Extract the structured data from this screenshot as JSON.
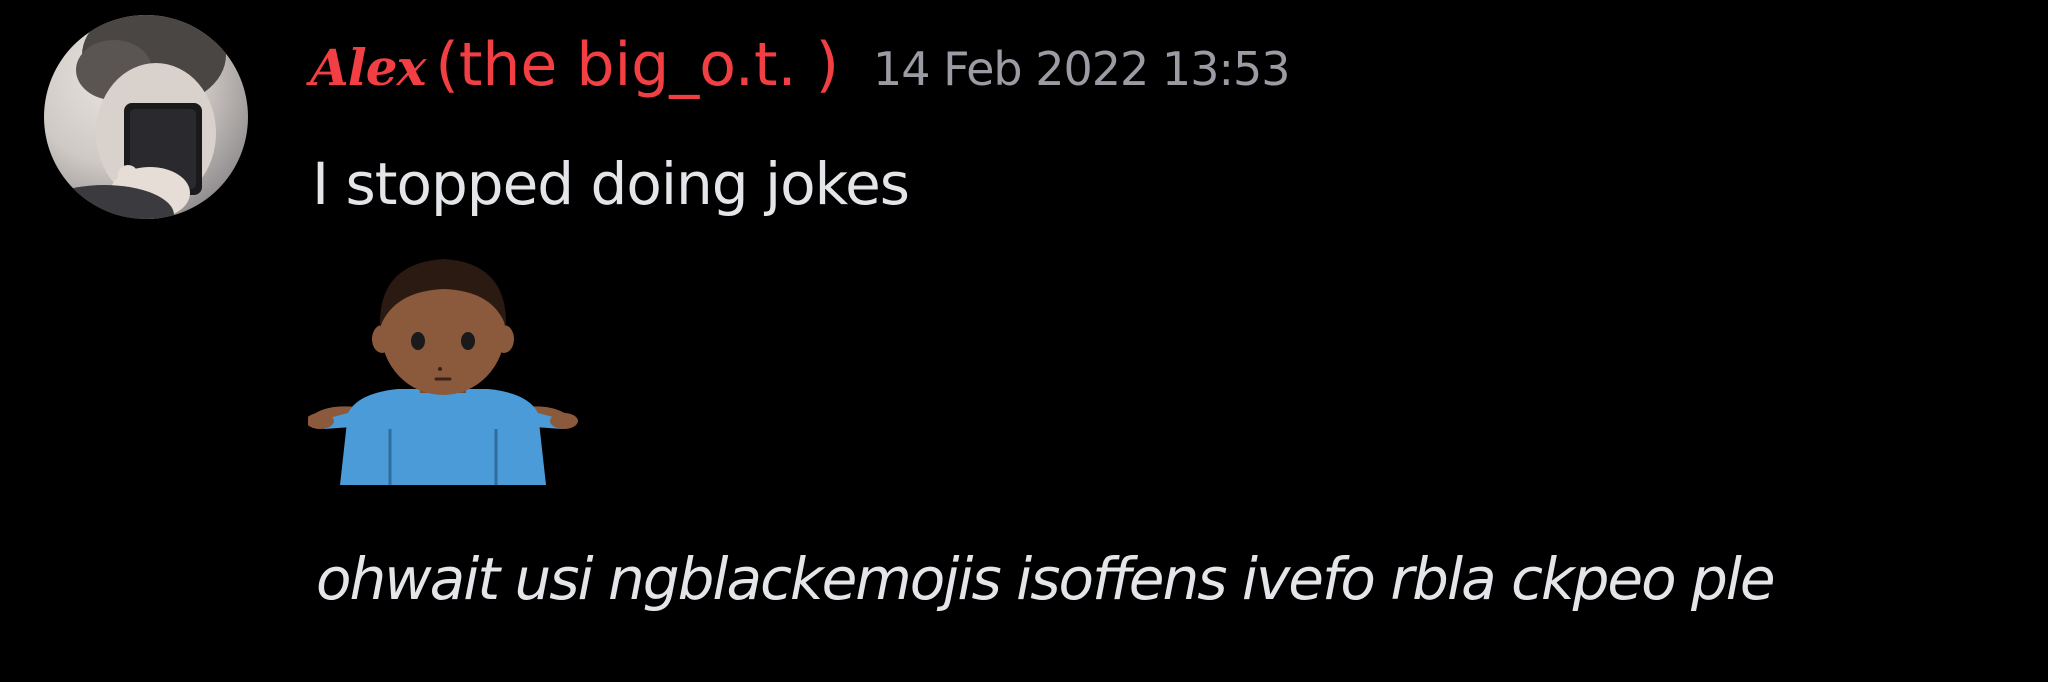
{
  "message": {
    "author": {
      "display_name": "Alex",
      "suffix": "(the big_o.t. )",
      "name_color": "#f23f43"
    },
    "timestamp": "14 Feb 2022 13:53",
    "text": "I stopped doing jokes",
    "emoji": {
      "name": "person-shrugging-medium-dark-skin-emoji",
      "glyph": "🤷🏾‍♂️"
    },
    "italic_text": "ohwait usi ngblackemojis isoffens ivefo rbla ckpeo ple"
  }
}
